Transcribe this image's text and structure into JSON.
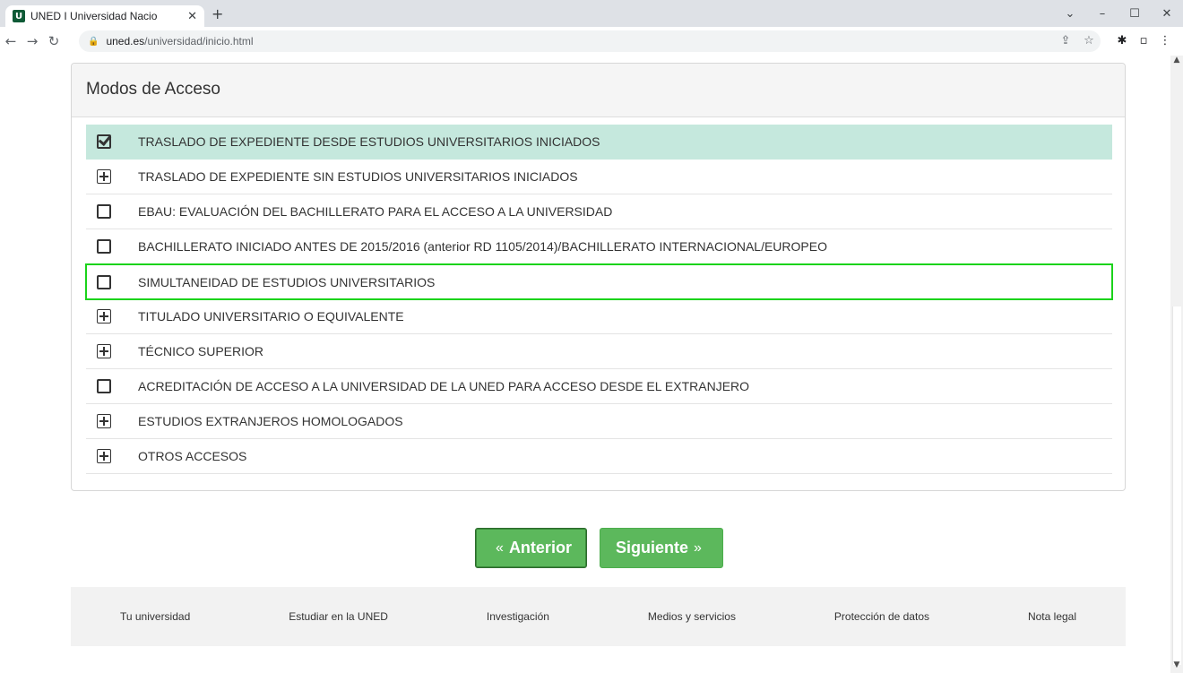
{
  "browser": {
    "tab_title": "UNED I Universidad Nacio",
    "favicon_letter": "U",
    "url_host": "uned.es",
    "url_path": "/universidad/inicio.html"
  },
  "panel": {
    "heading": "Modos de Acceso",
    "options": [
      {
        "label": "TRASLADO DE EXPEDIENTE DESDE ESTUDIOS UNIVERSITARIOS INICIADOS",
        "icon": "checked-checkbox-icon",
        "state": "selected"
      },
      {
        "label": "TRASLADO DE EXPEDIENTE SIN ESTUDIOS UNIVERSITARIOS INICIADOS",
        "icon": "expand-plus-icon",
        "state": ""
      },
      {
        "label": "EBAU: EVALUACIÓN DEL BACHILLERATO PARA EL ACCESO A LA UNIVERSIDAD",
        "icon": "checkbox-icon",
        "state": ""
      },
      {
        "label": "BACHILLERATO INICIADO ANTES DE 2015/2016 (anterior RD 1105/2014)/BACHILLERATO INTERNACIONAL/EUROPEO",
        "icon": "checkbox-icon",
        "state": ""
      },
      {
        "label": "SIMULTANEIDAD DE ESTUDIOS UNIVERSITARIOS",
        "icon": "checkbox-icon",
        "state": "highlighted"
      },
      {
        "label": "TITULADO UNIVERSITARIO O EQUIVALENTE",
        "icon": "expand-plus-icon",
        "state": ""
      },
      {
        "label": "TÉCNICO SUPERIOR",
        "icon": "expand-plus-icon",
        "state": ""
      },
      {
        "label": "ACREDITACIÓN DE ACCESO A LA UNIVERSIDAD DE LA UNED PARA ACCESO DESDE EL EXTRANJERO",
        "icon": "checkbox-icon",
        "state": ""
      },
      {
        "label": "ESTUDIOS EXTRANJEROS HOMOLOGADOS",
        "icon": "expand-plus-icon",
        "state": ""
      },
      {
        "label": "OTROS ACCESOS",
        "icon": "expand-plus-icon",
        "state": ""
      }
    ]
  },
  "buttons": {
    "prev_label": "Anterior",
    "prev_arrow": "«",
    "next_label": "Siguiente",
    "next_arrow": "»"
  },
  "footer": {
    "links": [
      "Tu universidad",
      "Estudiar en la UNED",
      "Investigación",
      "Medios y servicios",
      "Protección de datos",
      "Nota legal"
    ]
  },
  "colors": {
    "selected_row": "#c5e8dd",
    "highlight_outline": "#1bd31b",
    "button_green": "#5cb85c"
  }
}
